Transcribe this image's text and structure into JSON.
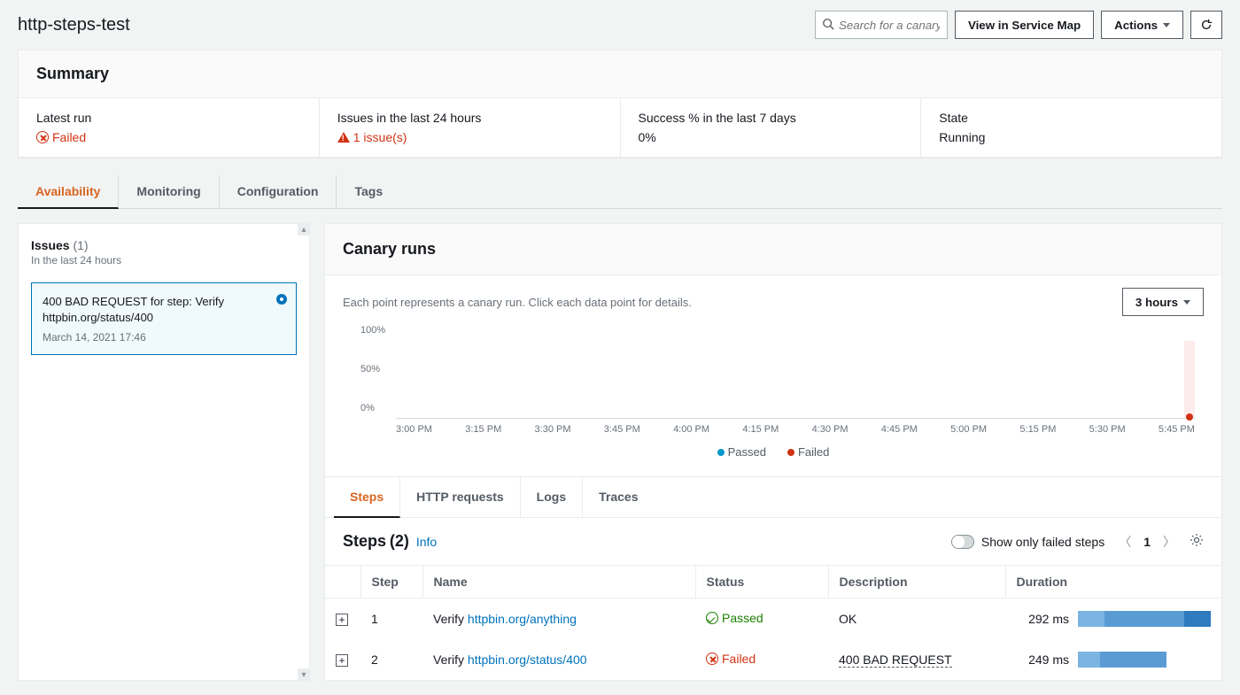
{
  "header": {
    "title": "http-steps-test",
    "searchPlaceholder": "Search for a canary",
    "viewServiceMap": "View in Service Map",
    "actions": "Actions"
  },
  "summary": {
    "title": "Summary",
    "cells": {
      "latestRun": {
        "label": "Latest run",
        "value": "Failed"
      },
      "issues24h": {
        "label": "Issues in the last 24 hours",
        "value": "1 issue(s)"
      },
      "success7d": {
        "label": "Success % in the last 7 days",
        "value": "0%"
      },
      "state": {
        "label": "State",
        "value": "Running"
      }
    }
  },
  "tabs": [
    "Availability",
    "Monitoring",
    "Configuration",
    "Tags"
  ],
  "issues": {
    "title": "Issues",
    "count": "(1)",
    "subtitle": "In the last 24 hours",
    "items": [
      {
        "title": "400 BAD REQUEST for step: Verify httpbin.org/status/400",
        "date": "March 14, 2021 17:46"
      }
    ]
  },
  "canaryRuns": {
    "title": "Canary runs",
    "hint": "Each point represents a canary run. Click each data point for details.",
    "range": "3 hours",
    "yTicks": [
      "100%",
      "50%",
      "0%"
    ],
    "xTicks": [
      "3:00 PM",
      "3:15 PM",
      "3:30 PM",
      "3:45 PM",
      "4:00 PM",
      "4:15 PM",
      "4:30 PM",
      "4:45 PM",
      "5:00 PM",
      "5:15 PM",
      "5:30 PM",
      "5:45 PM"
    ],
    "legend": {
      "passed": "Passed",
      "failed": "Failed"
    }
  },
  "subtabs": [
    "Steps",
    "HTTP requests",
    "Logs",
    "Traces"
  ],
  "steps": {
    "title": "Steps",
    "count": "(2)",
    "info": "Info",
    "toggleLabel": "Show only failed steps",
    "page": "1",
    "columns": {
      "step": "Step",
      "name": "Name",
      "status": "Status",
      "description": "Description",
      "duration": "Duration"
    },
    "rows": [
      {
        "step": "1",
        "namePrefix": "Verify ",
        "nameLink": "httpbin.org/anything",
        "status": "Passed",
        "statusType": "pass",
        "desc": "OK",
        "descDotted": false,
        "duration": "292 ms"
      },
      {
        "step": "2",
        "namePrefix": "Verify ",
        "nameLink": "httpbin.org/status/400",
        "status": "Failed",
        "statusType": "fail",
        "desc": "400 BAD REQUEST",
        "descDotted": true,
        "duration": "249 ms"
      }
    ]
  },
  "chart_data": {
    "type": "scatter",
    "title": "Canary runs",
    "xlabel": "",
    "ylabel": "",
    "ylim": [
      0,
      100
    ],
    "x": [
      "5:45 PM"
    ],
    "series": [
      {
        "name": "Passed",
        "values": []
      },
      {
        "name": "Failed",
        "values": [
          0
        ]
      }
    ]
  }
}
